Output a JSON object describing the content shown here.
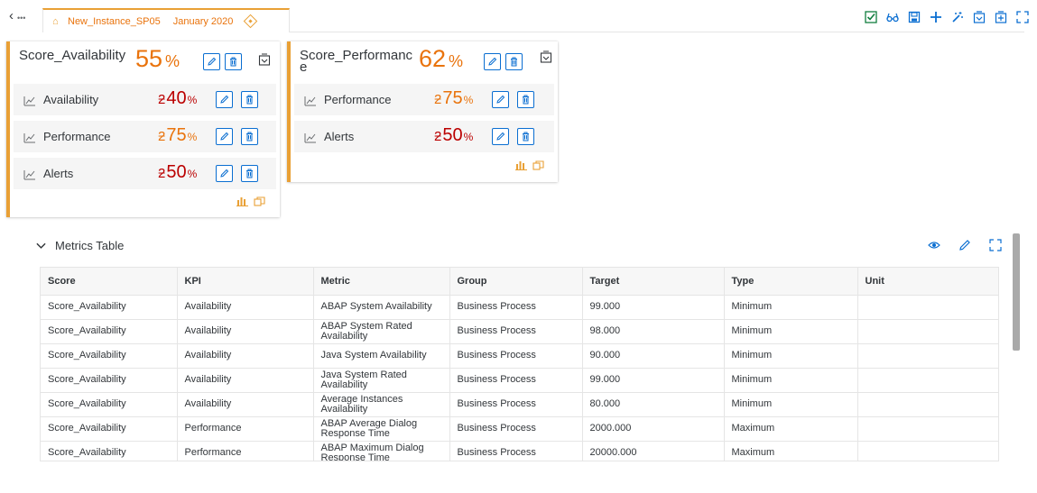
{
  "topbar": {
    "tab_title": "New_Instance_SP05",
    "tab_date": "January 2020",
    "toolbar_icons": [
      "check-icon",
      "glasses-icon",
      "save-icon",
      "add-icon",
      "magic-wand-icon",
      "collapse-all-icon",
      "expand-all-icon",
      "fullscreen-icon"
    ]
  },
  "cards": [
    {
      "title": "Score_Availability",
      "score": "55",
      "score_unit": "%",
      "kpis": [
        {
          "label": "Availability",
          "value": "40",
          "unit": "%",
          "color": "#bb0000"
        },
        {
          "label": "Performance",
          "value": "75",
          "unit": "%",
          "color": "#e9730c"
        },
        {
          "label": "Alerts",
          "value": "50",
          "unit": "%",
          "color": "#bb0000"
        }
      ]
    },
    {
      "title": "Score_Performance",
      "score": "62",
      "score_unit": "%",
      "kpis": [
        {
          "label": "Performance",
          "value": "75",
          "unit": "%",
          "color": "#e9730c"
        },
        {
          "label": "Alerts",
          "value": "50",
          "unit": "%",
          "color": "#bb0000"
        }
      ]
    }
  ],
  "metrics": {
    "title": "Metrics Table",
    "columns": [
      "Score",
      "KPI",
      "Metric",
      "Group",
      "Target",
      "Type",
      "Unit"
    ],
    "rows": [
      [
        "Score_Availability",
        "Availability",
        "ABAP System Availability",
        "Business Process",
        "99.000",
        "Minimum",
        ""
      ],
      [
        "Score_Availability",
        "Availability",
        "ABAP System Rated Availability",
        "Business Process",
        "98.000",
        "Minimum",
        ""
      ],
      [
        "Score_Availability",
        "Availability",
        "Java System Availability",
        "Business Process",
        "90.000",
        "Minimum",
        ""
      ],
      [
        "Score_Availability",
        "Availability",
        "Java System Rated Availability",
        "Business Process",
        "99.000",
        "Minimum",
        ""
      ],
      [
        "Score_Availability",
        "Availability",
        "Average Instances Availability",
        "Business Process",
        "80.000",
        "Minimum",
        ""
      ],
      [
        "Score_Availability",
        "Performance",
        "ABAP Average Dialog Response Time",
        "Business Process",
        "2000.000",
        "Maximum",
        ""
      ],
      [
        "Score_Availability",
        "Performance",
        "ABAP Maximum Dialog Response Time",
        "Business Process",
        "20000.000",
        "Maximum",
        ""
      ]
    ]
  },
  "colors": {
    "accent": "#e9a035",
    "score": "#e9730c",
    "critical": "#bb0000",
    "link": "#0a6ed1",
    "success": "#107e3e"
  }
}
